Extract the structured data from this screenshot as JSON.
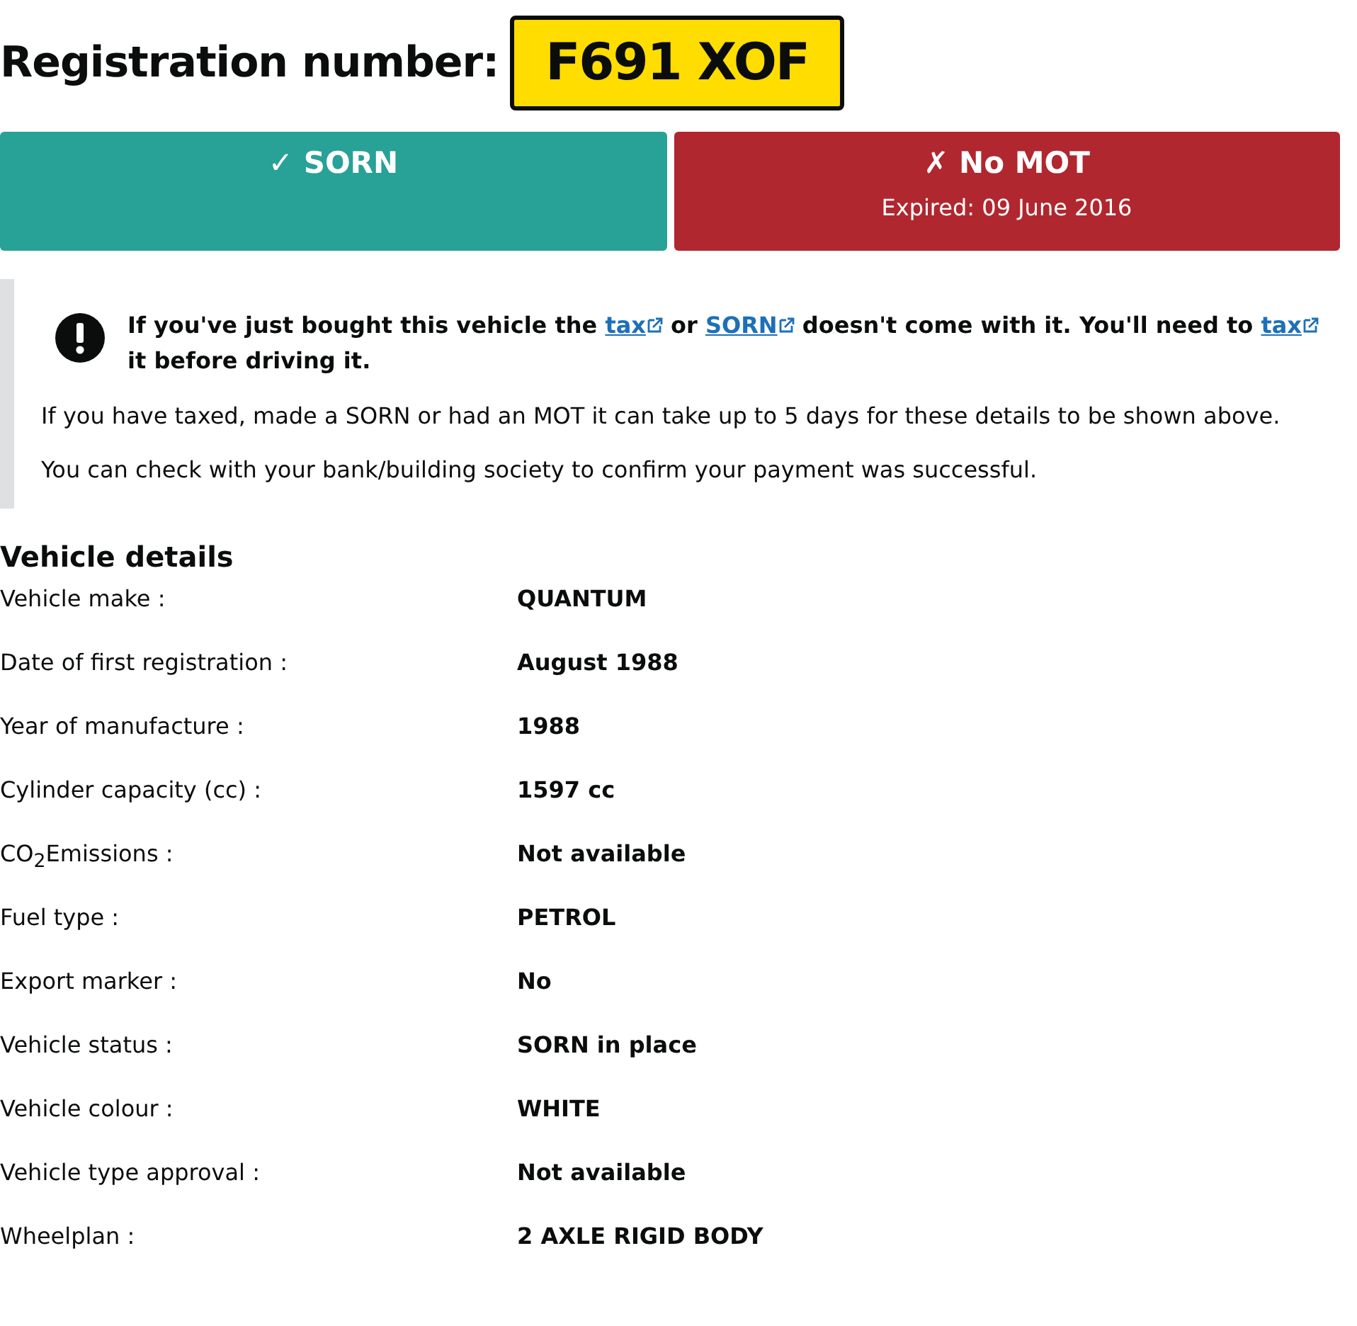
{
  "heading": {
    "label": "Registration number:",
    "plate": "F691 XOF"
  },
  "statuses": [
    {
      "kind": "ok",
      "title": "✓ SORN"
    },
    {
      "kind": "fail",
      "title": "✗ No MOT",
      "detail": "Expired: 09 June 2016"
    }
  ],
  "notice": {
    "warning": [
      {
        "kind": "text",
        "text": "If you've just bought this vehicle the "
      },
      {
        "kind": "link",
        "text": "tax"
      },
      {
        "kind": "text",
        "text": " or "
      },
      {
        "kind": "link",
        "text": "SORN"
      },
      {
        "kind": "text",
        "text": " doesn't come with it. You'll need to "
      },
      {
        "kind": "link",
        "text": "tax"
      },
      {
        "kind": "text",
        "text": " it before driving it."
      }
    ],
    "paragraphs": [
      "If you have taxed, made a SORN or had an MOT it can take up to 5 days for these details to be shown above.",
      "You can check with your bank/building society to confirm your payment was successful."
    ]
  },
  "details": {
    "title": "Vehicle details",
    "rows": [
      {
        "label": "Vehicle make :",
        "value": "QUANTUM"
      },
      {
        "label": "Date of first registration :",
        "value": "August 1988"
      },
      {
        "label": "Year of manufacture :",
        "value": "1988"
      },
      {
        "label": "Cylinder capacity (cc) :",
        "value": "1597 cc"
      },
      {
        "label": "CO$_{2}$Emissions :",
        "value": "Not available"
      },
      {
        "label": "Fuel type :",
        "value": "PETROL"
      },
      {
        "label": "Export marker :",
        "value": "No"
      },
      {
        "label": "Vehicle status :",
        "value": "SORN in place"
      },
      {
        "label": "Vehicle colour :",
        "value": "WHITE"
      },
      {
        "label": "Vehicle type approval :",
        "value": "Not available"
      },
      {
        "label": "Wheelplan :",
        "value": "2 AXLE RIGID BODY"
      }
    ]
  }
}
